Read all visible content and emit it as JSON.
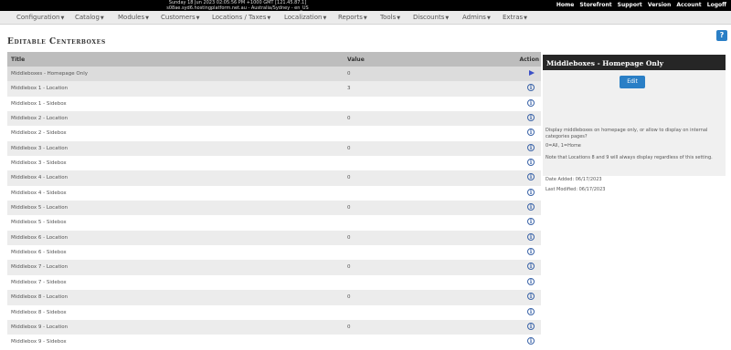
{
  "server_info": {
    "line1": "Sunday 18 Jun 2023 02:05:56 PM +1000 GMT [121.45.87.1]",
    "line2": "s08ae.syd6.hostingplatform.net.au - Australia/Sydney - en_US"
  },
  "top_links": [
    "Home",
    "Storefront",
    "Support",
    "Version",
    "Account",
    "Logoff"
  ],
  "menu": [
    "Configuration",
    "Catalog",
    "Modules",
    "Customers",
    "Locations / Taxes",
    "Localization",
    "Reports",
    "Tools",
    "Discounts",
    "Admins",
    "Extras"
  ],
  "page_title": "Editable Centerboxes",
  "help_label": "?",
  "table": {
    "headers": {
      "title": "Title",
      "value": "Value",
      "action": "Action"
    },
    "rows": [
      {
        "title": "Middleboxes - Homepage Only",
        "value": "0"
      },
      {
        "title": "Middlebox 1 - Location",
        "value": "3"
      },
      {
        "title": "Middlebox 1 - Sidebox",
        "value": ""
      },
      {
        "title": "Middlebox 2 - Location",
        "value": "0"
      },
      {
        "title": "Middlebox 2 - Sidebox",
        "value": ""
      },
      {
        "title": "Middlebox 3 - Location",
        "value": "0"
      },
      {
        "title": "Middlebox 3 - Sidebox",
        "value": ""
      },
      {
        "title": "Middlebox 4 - Location",
        "value": "0"
      },
      {
        "title": "Middlebox 4 - Sidebox",
        "value": ""
      },
      {
        "title": "Middlebox 5 - Location",
        "value": "0"
      },
      {
        "title": "Middlebox 5 - Sidebox",
        "value": ""
      },
      {
        "title": "Middlebox 6 - Location",
        "value": "0"
      },
      {
        "title": "Middlebox 6 - Sidebox",
        "value": ""
      },
      {
        "title": "Middlebox 7 - Location",
        "value": "0"
      },
      {
        "title": "Middlebox 7 - Sidebox",
        "value": ""
      },
      {
        "title": "Middlebox 8 - Location",
        "value": "0"
      },
      {
        "title": "Middlebox 8 - Sidebox",
        "value": ""
      },
      {
        "title": "Middlebox 9 - Location",
        "value": "0"
      },
      {
        "title": "Middlebox 9 - Sidebox",
        "value": ""
      }
    ]
  },
  "panel": {
    "title": "Middleboxes - Homepage Only",
    "edit_label": "Edit",
    "description": "Display middleboxes on homepage only, or allow to display on internal categories pages?",
    "options": "0=All, 1=Home",
    "note": "Note that Locations 8 and 9 will always display regardless of this setting.",
    "date_added": "Date Added: 06/17/2023",
    "last_modified": "Last Modified: 06/17/2023"
  },
  "colors": {
    "accent": "#2a7fc6",
    "header_bg": "#262626",
    "topbar_bg": "#000000"
  }
}
